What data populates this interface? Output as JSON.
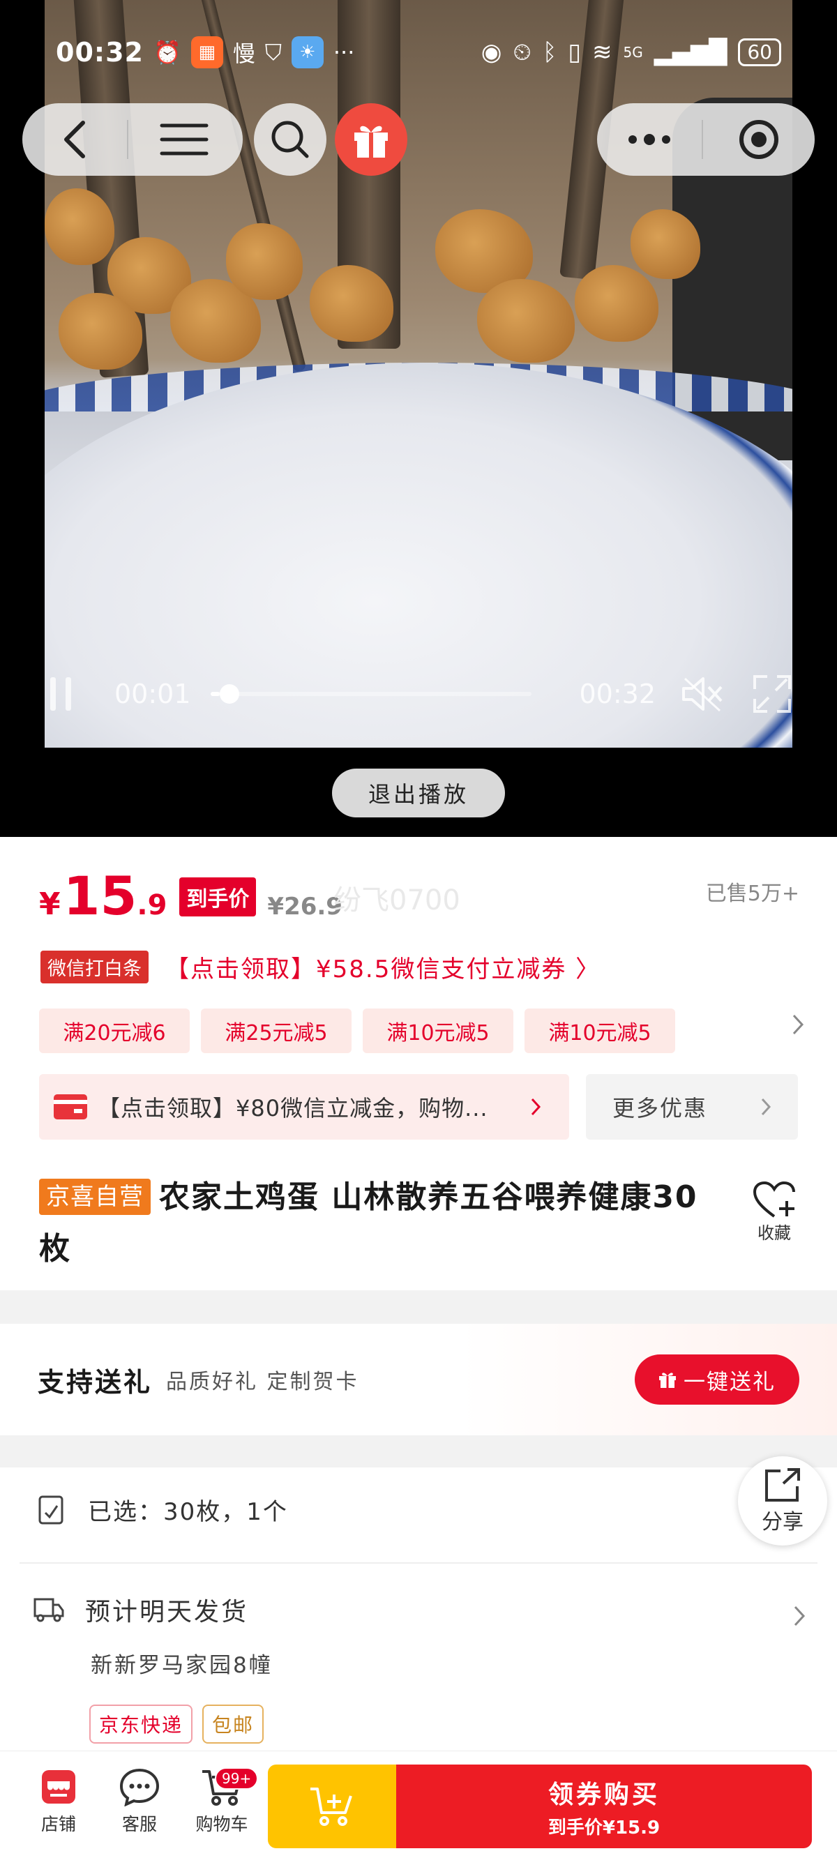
{
  "status_bar": {
    "time": "00:32",
    "battery": "60",
    "app_icon_text": "慢",
    "overflow": "···",
    "network": "5G"
  },
  "video": {
    "current_time": "00:01",
    "total_time": "00:32",
    "progress": 0.03,
    "exit_label": "退出播放"
  },
  "price": {
    "currency": "¥",
    "integer": "15",
    "decimal": ".9",
    "tag": "到手价",
    "original": "¥26.9",
    "watermark": "纷飞0700",
    "sold": "已售5万+"
  },
  "wechat_promo": {
    "badge": "微信打白条",
    "text": "【点击领取】¥58.5微信支付立减券 〉"
  },
  "coupons": [
    "满20元减6",
    "满25元减5",
    "满10元减5",
    "满10元减5"
  ],
  "promo_box": {
    "text": "【点击领取】¥80微信立减金，购物...",
    "more": "更多优惠"
  },
  "product": {
    "badge": "京喜自营",
    "title": "农家土鸡蛋 山林散养五谷喂养健康30枚",
    "favorite": "收藏"
  },
  "gift": {
    "title": "支持送礼",
    "subtitle": "品质好礼 定制贺卡",
    "button": "一键送礼"
  },
  "spec": {
    "selected": "已选：30枚，1个",
    "shipping": "预计明天发货",
    "address": "新新罗马家园8幢",
    "tags": [
      "京东快递",
      "包邮"
    ]
  },
  "share_label": "分享",
  "bottom_bar": {
    "store": "店铺",
    "service": "客服",
    "cart": "购物车",
    "cart_badge": "99+",
    "buy_line1": "领券购买",
    "buy_line2": "到手价¥15.9"
  },
  "colors": {
    "accent_red": "#e4002b",
    "buy_red": "#ed1c24",
    "cart_yellow": "#ffc300",
    "self_badge_orange": "#f07a1d"
  }
}
